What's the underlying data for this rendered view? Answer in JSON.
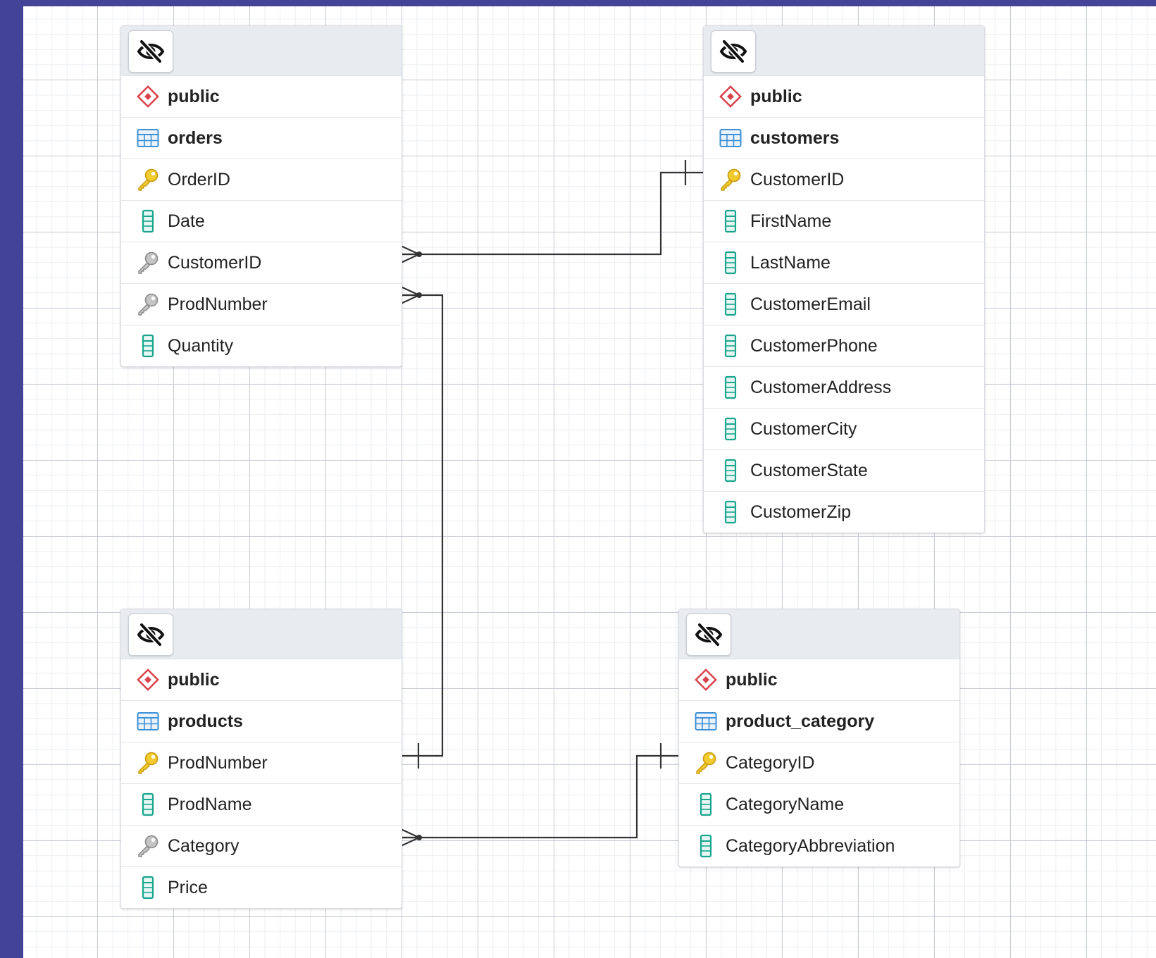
{
  "tables": {
    "orders": {
      "schema": "public",
      "name": "orders",
      "columns": [
        {
          "name": "OrderID",
          "key": "primary"
        },
        {
          "name": "Date",
          "key": "none"
        },
        {
          "name": "CustomerID",
          "key": "foreign"
        },
        {
          "name": "ProdNumber",
          "key": "foreign"
        },
        {
          "name": "Quantity",
          "key": "none"
        }
      ]
    },
    "customers": {
      "schema": "public",
      "name": "customers",
      "columns": [
        {
          "name": "CustomerID",
          "key": "primary"
        },
        {
          "name": "FirstName",
          "key": "none"
        },
        {
          "name": "LastName",
          "key": "none"
        },
        {
          "name": "CustomerEmail",
          "key": "none"
        },
        {
          "name": "CustomerPhone",
          "key": "none"
        },
        {
          "name": "CustomerAddress",
          "key": "none"
        },
        {
          "name": "CustomerCity",
          "key": "none"
        },
        {
          "name": "CustomerState",
          "key": "none"
        },
        {
          "name": "CustomerZip",
          "key": "none"
        }
      ]
    },
    "products": {
      "schema": "public",
      "name": "products",
      "columns": [
        {
          "name": "ProdNumber",
          "key": "primary"
        },
        {
          "name": "ProdName",
          "key": "none"
        },
        {
          "name": "Category",
          "key": "foreign"
        },
        {
          "name": "Price",
          "key": "none"
        }
      ]
    },
    "product_category": {
      "schema": "public",
      "name": "product_category",
      "columns": [
        {
          "name": "CategoryID",
          "key": "primary"
        },
        {
          "name": "CategoryName",
          "key": "none"
        },
        {
          "name": "CategoryAbbreviation",
          "key": "none"
        }
      ]
    }
  },
  "relationships": [
    {
      "from": "orders.CustomerID",
      "to": "customers.CustomerID",
      "from_end": "many",
      "to_end": "one"
    },
    {
      "from": "orders.ProdNumber",
      "to": "products.ProdNumber",
      "from_end": "many",
      "to_end": "one"
    },
    {
      "from": "products.Category",
      "to": "product_category.CategoryID",
      "from_end": "many",
      "to_end": "one"
    }
  ],
  "icons": {
    "hide": "eye-slash-icon",
    "schema": "schema-diamond-icon",
    "table": "table-grid-icon",
    "primary_key": "primary-key-icon",
    "foreign_key": "foreign-key-icon",
    "column": "column-icon"
  },
  "colors": {
    "frame": "#434398",
    "schema_icon": "#d9424a",
    "table_icon": "#3d8fd6",
    "primary_key": "#e8b820",
    "foreign_key": "#9a9a9a",
    "column_icon": "#19a58e"
  }
}
